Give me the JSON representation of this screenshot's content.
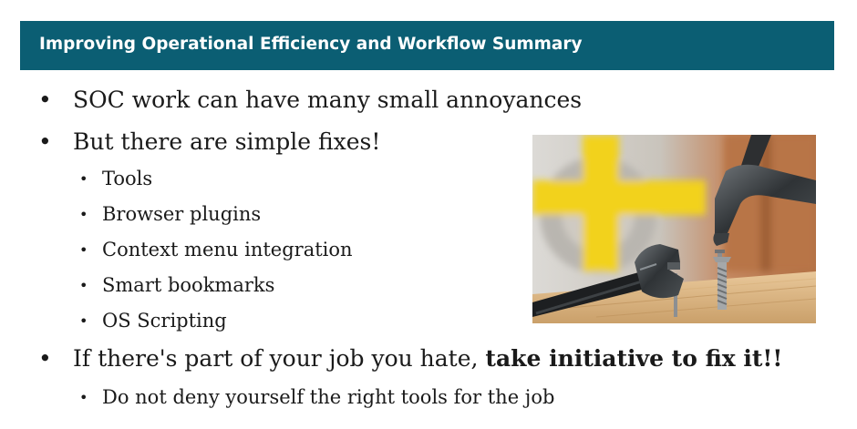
{
  "header": {
    "title": "Improving Operational  Efficiency and Workflow Summary"
  },
  "bullets": {
    "b1": "SOC work can have many small annoyances",
    "b2": "But there are simple fixes!",
    "sub": [
      "Tools",
      "Browser plugins",
      "Context menu integration",
      "Smart bookmarks",
      "OS Scripting"
    ],
    "b3_prefix": "If there's part of your job you hate, ",
    "b3_bold": "take initiative to fix it!!",
    "b3_sub": "Do not deny yourself the right tools for the job"
  },
  "colors": {
    "header_bg": "#0b5e73",
    "header_text": "#ffffff",
    "body_text": "#1a1a1a"
  },
  "image": {
    "subject": "hammer-wrench-nail-screw-photo"
  }
}
